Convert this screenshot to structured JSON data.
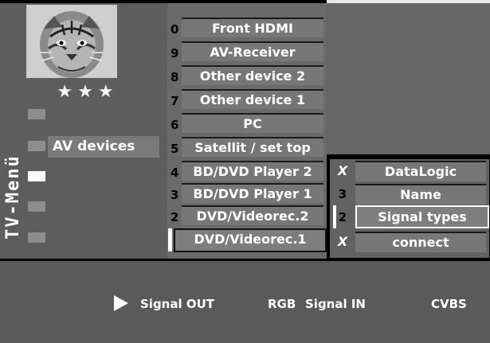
{
  "side_title": "TV-Menü",
  "rating": "★★★",
  "left_menu": {
    "active_label": "AV devices"
  },
  "av_list": [
    {
      "num": "0",
      "label": "Front HDMI"
    },
    {
      "num": "9",
      "label": "AV-Receiver"
    },
    {
      "num": "8",
      "label": "Other device 2"
    },
    {
      "num": "7",
      "label": "Other device 1"
    },
    {
      "num": "6",
      "label": "PC"
    },
    {
      "num": "5",
      "label": "Satellit / set top"
    },
    {
      "num": "4",
      "label": "BD/DVD Player 2"
    },
    {
      "num": "3",
      "label": "BD/DVD Player 1"
    },
    {
      "num": "2",
      "label": "DVD/Videorec.2"
    },
    {
      "num": "1",
      "label": "DVD/Videorec.1"
    }
  ],
  "sub_menu": [
    {
      "mark": "X",
      "label": "DataLogic"
    },
    {
      "mark": "3",
      "label": "Name"
    },
    {
      "mark": "2",
      "label": "Signal types"
    },
    {
      "mark": "X",
      "label": "connect"
    }
  ],
  "info_bar": {
    "signal_out": "Signal OUT",
    "rgb": "RGB",
    "signal_in": "Signal IN",
    "cvbs": "CVBS"
  },
  "colors": {
    "panel": "#5d5d5d",
    "item": "#777777",
    "highlight": "#ffffff"
  }
}
